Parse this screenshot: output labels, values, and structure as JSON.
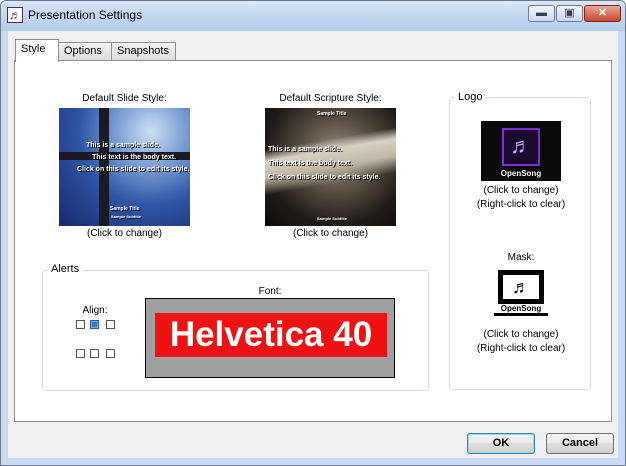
{
  "window": {
    "title": "Presentation Settings",
    "min_label": "▬",
    "max_label": "▣",
    "close_label": "✕",
    "app_icon_glyph": "♬"
  },
  "tabs": [
    {
      "label": "Style",
      "active": true
    },
    {
      "label": "Options",
      "active": false
    },
    {
      "label": "Snapshots",
      "active": false
    }
  ],
  "style": {
    "default_slide_label": "Default Slide Style:",
    "default_scripture_label": "Default Scripture Style:",
    "click_to_change": "(Click to change)",
    "slide": {
      "line1": "This is a sample slide.",
      "line2": "This text is the body text.",
      "line3": "Click on this slide to edit its style.",
      "title": "Sample Title",
      "subtitle": "Sample Subtitle"
    },
    "scripture": {
      "title": "Sample Title",
      "line1": "This is a sample slide.",
      "line2": "This text is the body text.",
      "line3": "Click on this slide to edit its style.",
      "subtitle": "Sample Subtitle"
    }
  },
  "alerts": {
    "title": "Alerts",
    "align_label": "Align:",
    "font_label": "Font:",
    "font_sample": "Helvetica 40",
    "align_selected": "top-center"
  },
  "logo": {
    "title": "Logo",
    "brand": "OpenSong",
    "glyph": "♬",
    "click_to_change": "(Click to change)",
    "right_click_clear": "(Right-click to clear)",
    "mask_label": "Mask:",
    "mask_brand": "OpenSong",
    "mask_glyph": "♬",
    "mask_click_to_change": "(Click to change)",
    "mask_right_click_clear": "(Right-click to clear)"
  },
  "buttons": {
    "ok": "OK",
    "cancel": "Cancel"
  },
  "colors": {
    "font_sample_bg": "#ee1111",
    "logo_frame": "#7a2fd8"
  }
}
